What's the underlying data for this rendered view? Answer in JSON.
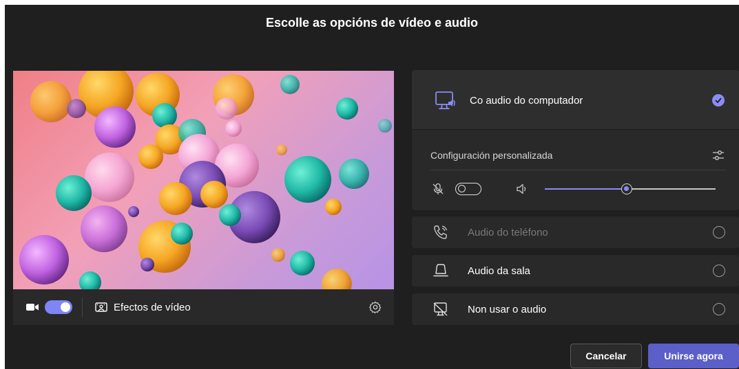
{
  "dialog": {
    "title": "Escolle as opcións de vídeo e audio"
  },
  "video": {
    "camera_enabled": true,
    "effects_label": "Efectos de vídeo"
  },
  "audio_options": {
    "selected": {
      "label": "Co audio do computador",
      "icon": "computer-audio-icon",
      "checked": true
    },
    "custom_settings_label": "Configuración personalizada",
    "mic_enabled": false,
    "speaker_volume": 0.48,
    "others": [
      {
        "label": "Audio do teléfono",
        "icon": "phone-audio-icon",
        "disabled": true
      },
      {
        "label": "Audio da sala",
        "icon": "room-audio-icon",
        "disabled": false
      },
      {
        "label": "Non usar o audio",
        "icon": "no-audio-icon",
        "disabled": false
      }
    ]
  },
  "actions": {
    "cancel_label": "Cancelar",
    "join_label": "Unirse agora"
  },
  "colors": {
    "accent": "#5b5fc7",
    "accent_light": "#7f85f5",
    "background": "#1f1f1f",
    "panel": "#292929"
  }
}
